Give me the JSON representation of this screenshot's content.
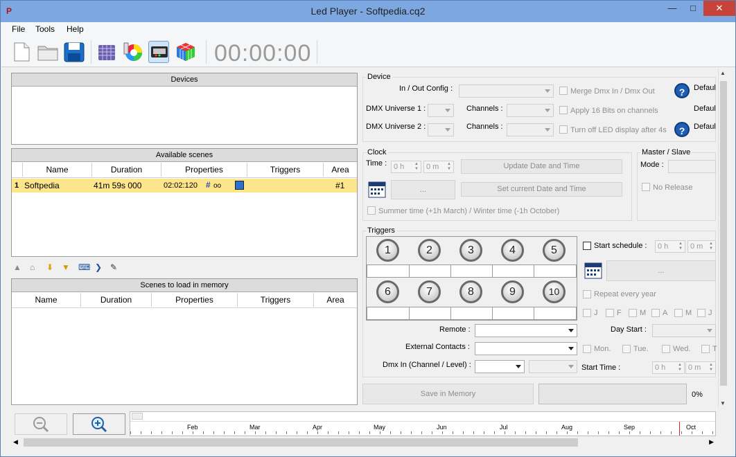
{
  "window": {
    "title": "Led Player - Softpedia.cq2",
    "app_icon": "P"
  },
  "menu": [
    "File",
    "Tools",
    "Help"
  ],
  "toolbar": {
    "timer": "00:00:00"
  },
  "devices": {
    "header": "Devices"
  },
  "available_scenes": {
    "header": "Available scenes",
    "columns": [
      "Name",
      "Duration",
      "Properties",
      "Triggers",
      "Area"
    ],
    "rows": [
      {
        "index": "1",
        "name": "Softpedia",
        "duration": "41m 59s 000",
        "properties": "02:02:120",
        "prop_extra": "oo",
        "triggers": "",
        "area": "#1"
      }
    ]
  },
  "memory_scenes": {
    "header": "Scenes to load in memory",
    "columns": [
      "Name",
      "Duration",
      "Properties",
      "Triggers",
      "Area"
    ]
  },
  "device": {
    "title": "Device",
    "in_out_label": "In / Out Config :",
    "dmx_u1_label": "DMX Universe 1 :",
    "dmx_u2_label": "DMX Universe 2 :",
    "channels_label": "Channels :",
    "merge_label": "Merge Dmx In / Dmx Out",
    "bits_label": "Apply 16 Bits on channels",
    "turnoff_label": "Turn off LED display after 4s",
    "default_label": "Defaul"
  },
  "clock": {
    "title": "Clock",
    "time_label": "Time :",
    "hour": "0 h",
    "minute": "0 m",
    "update_btn": "Update Date and Time",
    "ellipsis_btn": "...",
    "set_current_btn": "Set current Date and Time",
    "summer_label": "Summer time (+1h March) / Winter time (-1h October)"
  },
  "master": {
    "title": "Master / Slave",
    "mode_label": "Mode :",
    "no_release": "No Release"
  },
  "triggers": {
    "title": "Triggers",
    "buttons": [
      "1",
      "2",
      "3",
      "4",
      "5",
      "6",
      "7",
      "8",
      "9",
      "10"
    ],
    "start_schedule": "Start schedule :",
    "sched_h": "0 h",
    "sched_m": "0 m",
    "sched_btn": "...",
    "repeat_label": "Repeat every year",
    "months": [
      "J",
      "F",
      "M",
      "A",
      "M",
      "J"
    ],
    "day_start_label": "Day Start :",
    "days": [
      "Mon.",
      "Tue.",
      "Wed.",
      "T"
    ],
    "start_time_label": "Start Time :",
    "start_h": "0 h",
    "start_m": "0 m",
    "remote_label": "Remote :",
    "ext_label": "External Contacts :",
    "dmx_in_label": "Dmx In (Channel / Level) :"
  },
  "save": {
    "button": "Save in Memory",
    "percent": "0%"
  },
  "timeline": {
    "months": [
      "Feb",
      "Mar",
      "Apr",
      "May",
      "Jun",
      "Jul",
      "Aug",
      "Sep",
      "Oct"
    ]
  },
  "colors": {
    "titlebar": "#7da7e0",
    "selected_row": "#fce58a",
    "accent": "#1e5eb4"
  }
}
